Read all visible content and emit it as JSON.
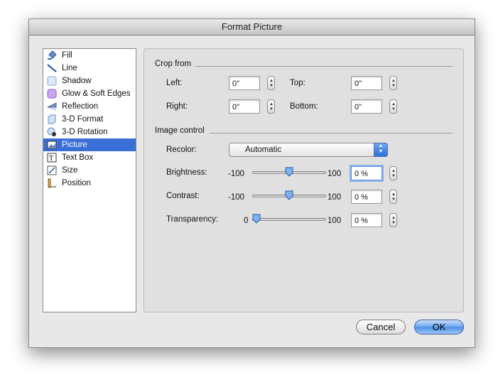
{
  "window": {
    "title": "Format Picture"
  },
  "sidebar": {
    "selected_index": 8,
    "items": [
      {
        "label": "Fill",
        "icon": "fill-bucket-icon"
      },
      {
        "label": "Line",
        "icon": "line-icon"
      },
      {
        "label": "Shadow",
        "icon": "shadow-icon"
      },
      {
        "label": "Glow & Soft Edges",
        "icon": "glow-icon"
      },
      {
        "label": "Reflection",
        "icon": "reflection-icon"
      },
      {
        "label": "3-D Format",
        "icon": "3d-format-icon"
      },
      {
        "label": "3-D Rotation",
        "icon": "3d-rotation-icon"
      },
      {
        "label": "Picture",
        "icon": "picture-icon"
      },
      {
        "label": "Text Box",
        "icon": "text-box-icon"
      },
      {
        "label": "Size",
        "icon": "size-icon"
      },
      {
        "label": "Position",
        "icon": "position-icon"
      }
    ]
  },
  "crop": {
    "title": "Crop from",
    "left_label": "Left:",
    "left_value": "0\"",
    "top_label": "Top:",
    "top_value": "0\"",
    "right_label": "Right:",
    "right_value": "0\"",
    "bottom_label": "Bottom:",
    "bottom_value": "0\""
  },
  "image_control": {
    "title": "Image control",
    "recolor_label": "Recolor:",
    "recolor_value": "Automatic",
    "brightness": {
      "label": "Brightness:",
      "min": "-100",
      "max": "100",
      "value": "0 %",
      "level": 0.5
    },
    "contrast": {
      "label": "Contrast:",
      "min": "-100",
      "max": "100",
      "value": "0 %",
      "level": 0.5
    },
    "transparency": {
      "label": "Transparency:",
      "min": "0",
      "max": "100",
      "value": "0 %",
      "level": 0.0
    }
  },
  "buttons": {
    "cancel": "Cancel",
    "ok": "OK"
  },
  "colors": {
    "selection": "#3a6fd8",
    "default_button": "#4b8ee7"
  }
}
